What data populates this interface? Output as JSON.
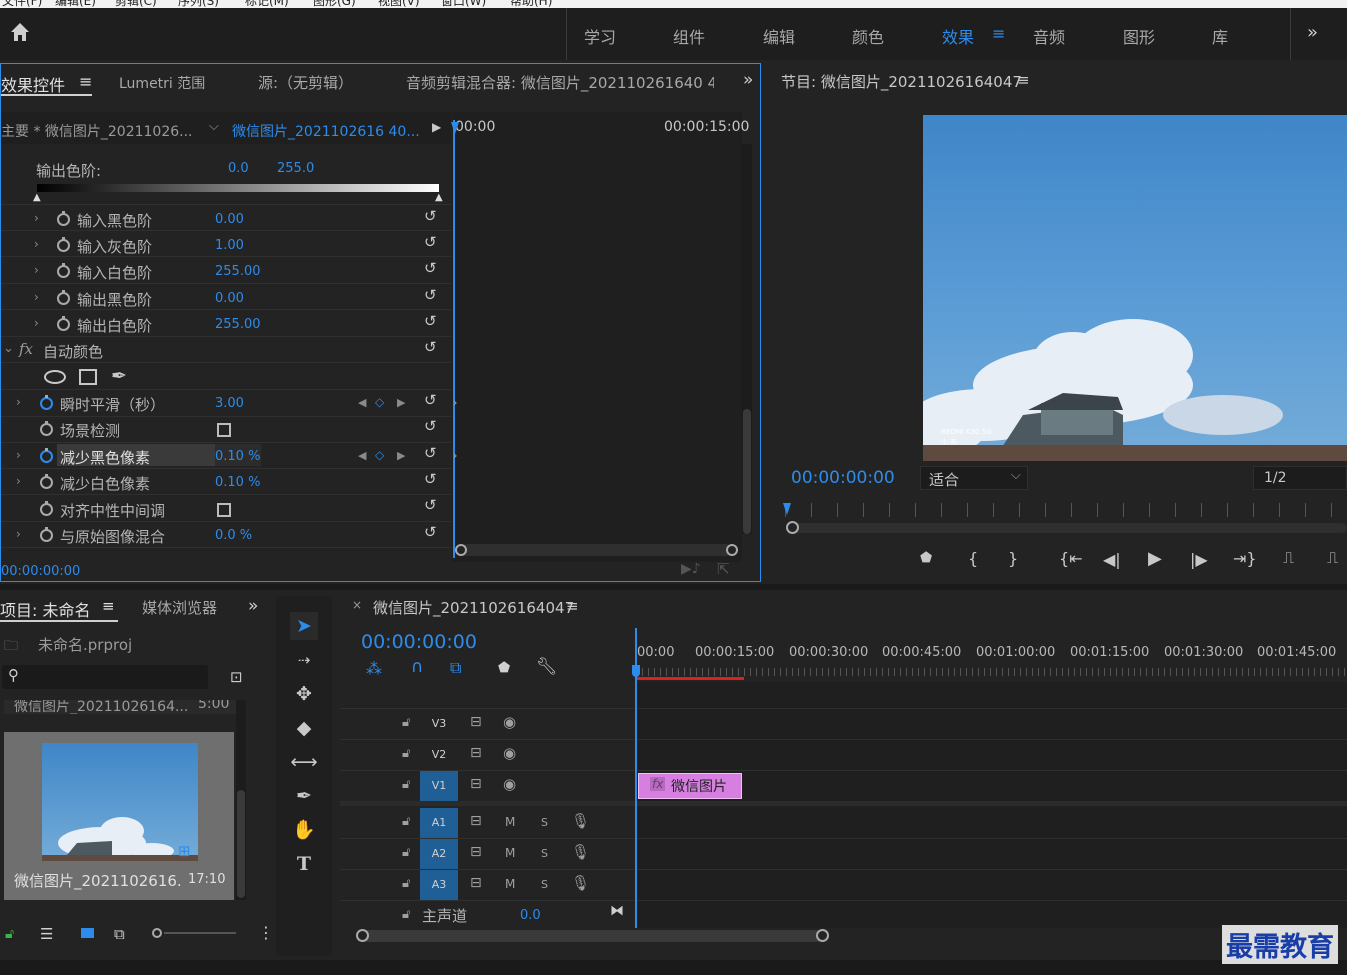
{
  "menu": [
    "文件(F)",
    "编辑(E)",
    "剪辑(C)",
    "序列(S)",
    "标记(M)",
    "图形(G)",
    "视图(V)",
    "窗口(W)",
    "帮助(H)"
  ],
  "workspaces": {
    "items": [
      "学习",
      "组件",
      "编辑",
      "颜色",
      "效果",
      "音频",
      "图形",
      "库"
    ],
    "active": "效果",
    "more": "»"
  },
  "effect_panel": {
    "tabs": [
      "效果控件",
      "Lumetri 范围",
      "源:（无剪辑）",
      "音频剪辑混合器: 微信图片_202110261640 4"
    ],
    "tab_active_label": "效果控件",
    "more": "»",
    "master_label": "主要 * 微信图片_20211026...",
    "clip_label": "微信图片_2021102616 40...",
    "timeline_start": "00:00",
    "timeline_end": "00:00:15:00",
    "output_levels_label": "输出色阶:",
    "output_levels_low": "0.0",
    "output_levels_high": "255.0",
    "rows": [
      {
        "label": "输入黑色阶",
        "value": "0.00"
      },
      {
        "label": "输入灰色阶",
        "value": "1.00"
      },
      {
        "label": "输入白色阶",
        "value": "255.00"
      },
      {
        "label": "输出黑色阶",
        "value": "0.00"
      },
      {
        "label": "输出白色阶",
        "value": "255.00"
      }
    ],
    "auto_color_label": "自动颜色",
    "fx_glyph": "fx",
    "auto_rows": [
      {
        "label": "瞬时平滑（秒）",
        "value": "3.00"
      },
      {
        "label": "场景检测",
        "value": ""
      },
      {
        "label": "减少黑色像素",
        "value": "0.10 %"
      },
      {
        "label": "减少白色像素",
        "value": "0.10 %"
      },
      {
        "label": "对齐中性中间调",
        "value": ""
      },
      {
        "label": "与原始图像混合",
        "value": "0.0 %"
      }
    ],
    "timecode": "00:00:00:00"
  },
  "program_monitor": {
    "title": "节目: 微信图片_20211026164047",
    "timecode": "00:00:00:00",
    "fit": "适合",
    "resolution": "1/2",
    "watermark_line1": "REDMI K30 5G",
    "watermark_line2": "小 布"
  },
  "project_panel": {
    "tab_label": "项目: 未命名",
    "tab2_label": "媒体浏览器",
    "more": "»",
    "project_file": "未命名.prproj",
    "bin_item": "微信图片_20211026164...",
    "bin_item_duration": "5:00",
    "clip_name": "微信图片_2021102616...",
    "clip_duration": "17:10"
  },
  "timeline": {
    "sequence_name": "微信图片_20211026164047",
    "timecode": "00:00:00:00",
    "ruler": [
      "00:00",
      "00:00:15:00",
      "00:00:30:00",
      "00:00:45:00",
      "00:01:00:00",
      "00:01:15:00",
      "00:01:30:00",
      "00:01:45:00"
    ],
    "video_tracks": [
      "V3",
      "V2",
      "V1"
    ],
    "audio_tracks": [
      "A1",
      "A2",
      "A3"
    ],
    "mute": "M",
    "solo": "S",
    "master_label": "主声道",
    "master_value": "0.0",
    "clip_label": "微信图片",
    "clip_fx": "fx"
  },
  "brand": "最需教育"
}
